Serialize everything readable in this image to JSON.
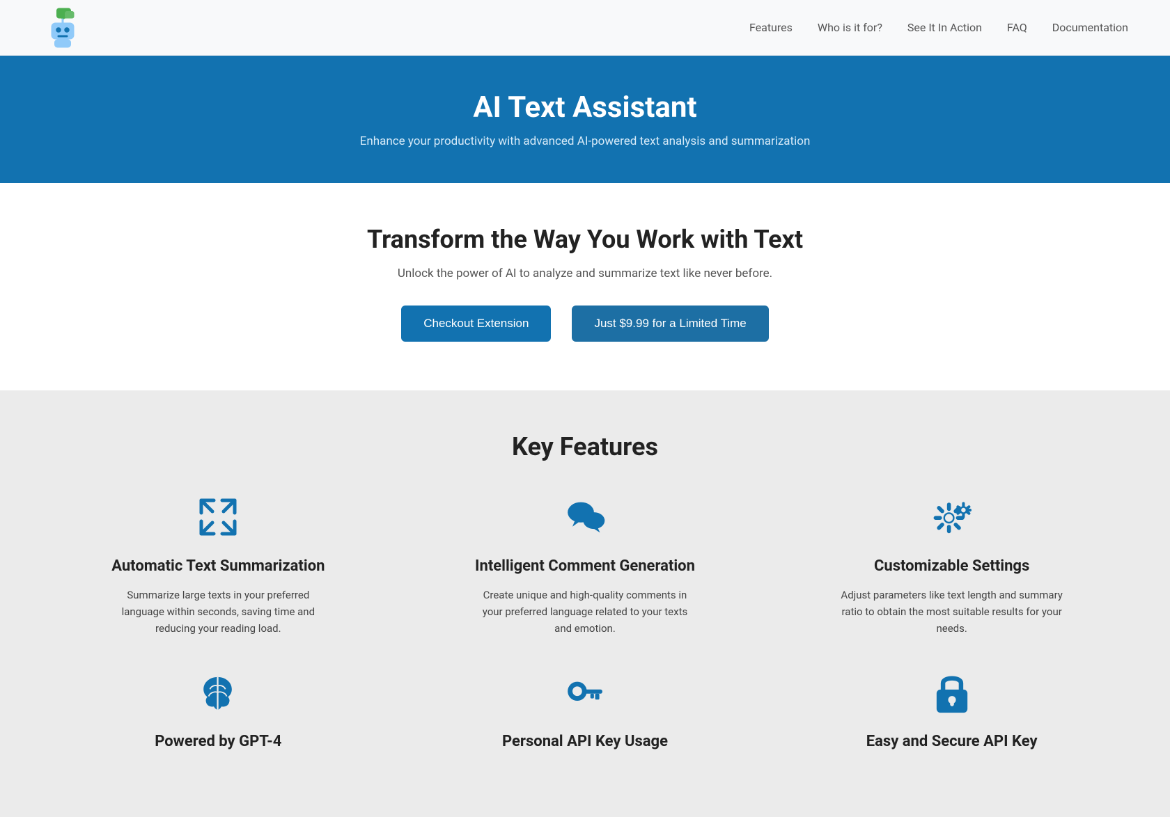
{
  "nav": {
    "links": [
      {
        "label": "Features",
        "id": "features"
      },
      {
        "label": "Who is it for?",
        "id": "who"
      },
      {
        "label": "See It In Action",
        "id": "action"
      },
      {
        "label": "FAQ",
        "id": "faq"
      },
      {
        "label": "Documentation",
        "id": "docs"
      }
    ]
  },
  "hero": {
    "title": "AI Text Assistant",
    "subtitle": "Enhance your productivity with advanced AI-powered text analysis and summarization"
  },
  "cta": {
    "heading": "Transform the Way You Work with Text",
    "description": "Unlock the power of AI to analyze and summarize text like never before.",
    "button1": "Checkout Extension",
    "button2": "Just $9.99 for a Limited Time"
  },
  "features": {
    "heading": "Key Features",
    "items": [
      {
        "id": "summarization",
        "title": "Automatic Text Summarization",
        "description": "Summarize large texts in your preferred language within seconds, saving time and reducing your reading load.",
        "icon": "compress"
      },
      {
        "id": "comment",
        "title": "Intelligent Comment Generation",
        "description": "Create unique and high-quality comments in your preferred language related to your texts and emotion.",
        "icon": "chat"
      },
      {
        "id": "settings",
        "title": "Customizable Settings",
        "description": "Adjust parameters like text length and summary ratio to obtain the most suitable results for your needs.",
        "icon": "gear"
      },
      {
        "id": "gpt4",
        "title": "Powered by GPT-4",
        "description": "",
        "icon": "brain"
      },
      {
        "id": "api",
        "title": "Personal API Key Usage",
        "description": "",
        "icon": "key"
      },
      {
        "id": "secure",
        "title": "Easy and Secure API Key",
        "description": "",
        "icon": "lock"
      }
    ]
  }
}
